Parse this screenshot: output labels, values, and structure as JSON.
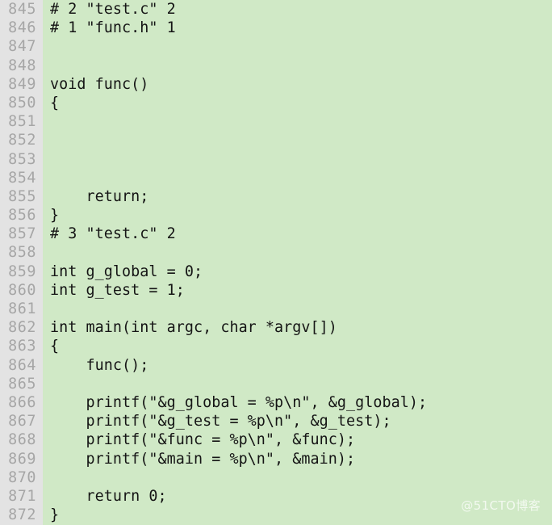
{
  "viewer": {
    "name": "code-viewer",
    "language": "c",
    "colors": {
      "code_background": "#d0e9c6",
      "gutter_background": "#e3e3e3",
      "code_text": "#151515",
      "line_number_text": "#a6a6a6",
      "watermark_text": "#ffffff"
    },
    "first_line_number": 845,
    "last_line_number": 872,
    "line_count": 28
  },
  "watermark": {
    "text": "@51CTO博客"
  },
  "lines": [
    {
      "number": "845",
      "code": "# 2 \"test.c\" 2"
    },
    {
      "number": "846",
      "code": "# 1 \"func.h\" 1"
    },
    {
      "number": "847",
      "code": ""
    },
    {
      "number": "848",
      "code": ""
    },
    {
      "number": "849",
      "code": "void func()"
    },
    {
      "number": "850",
      "code": "{"
    },
    {
      "number": "851",
      "code": ""
    },
    {
      "number": "852",
      "code": ""
    },
    {
      "number": "853",
      "code": ""
    },
    {
      "number": "854",
      "code": ""
    },
    {
      "number": "855",
      "code": "    return;"
    },
    {
      "number": "856",
      "code": "}"
    },
    {
      "number": "857",
      "code": "# 3 \"test.c\" 2"
    },
    {
      "number": "858",
      "code": ""
    },
    {
      "number": "859",
      "code": "int g_global = 0;"
    },
    {
      "number": "860",
      "code": "int g_test = 1;"
    },
    {
      "number": "861",
      "code": ""
    },
    {
      "number": "862",
      "code": "int main(int argc, char *argv[])"
    },
    {
      "number": "863",
      "code": "{"
    },
    {
      "number": "864",
      "code": "    func();"
    },
    {
      "number": "865",
      "code": ""
    },
    {
      "number": "866",
      "code": "    printf(\"&g_global = %p\\n\", &g_global);"
    },
    {
      "number": "867",
      "code": "    printf(\"&g_test = %p\\n\", &g_test);"
    },
    {
      "number": "868",
      "code": "    printf(\"&func = %p\\n\", &func);"
    },
    {
      "number": "869",
      "code": "    printf(\"&main = %p\\n\", &main);"
    },
    {
      "number": "870",
      "code": ""
    },
    {
      "number": "871",
      "code": "    return 0;"
    },
    {
      "number": "872",
      "code": "}"
    }
  ]
}
